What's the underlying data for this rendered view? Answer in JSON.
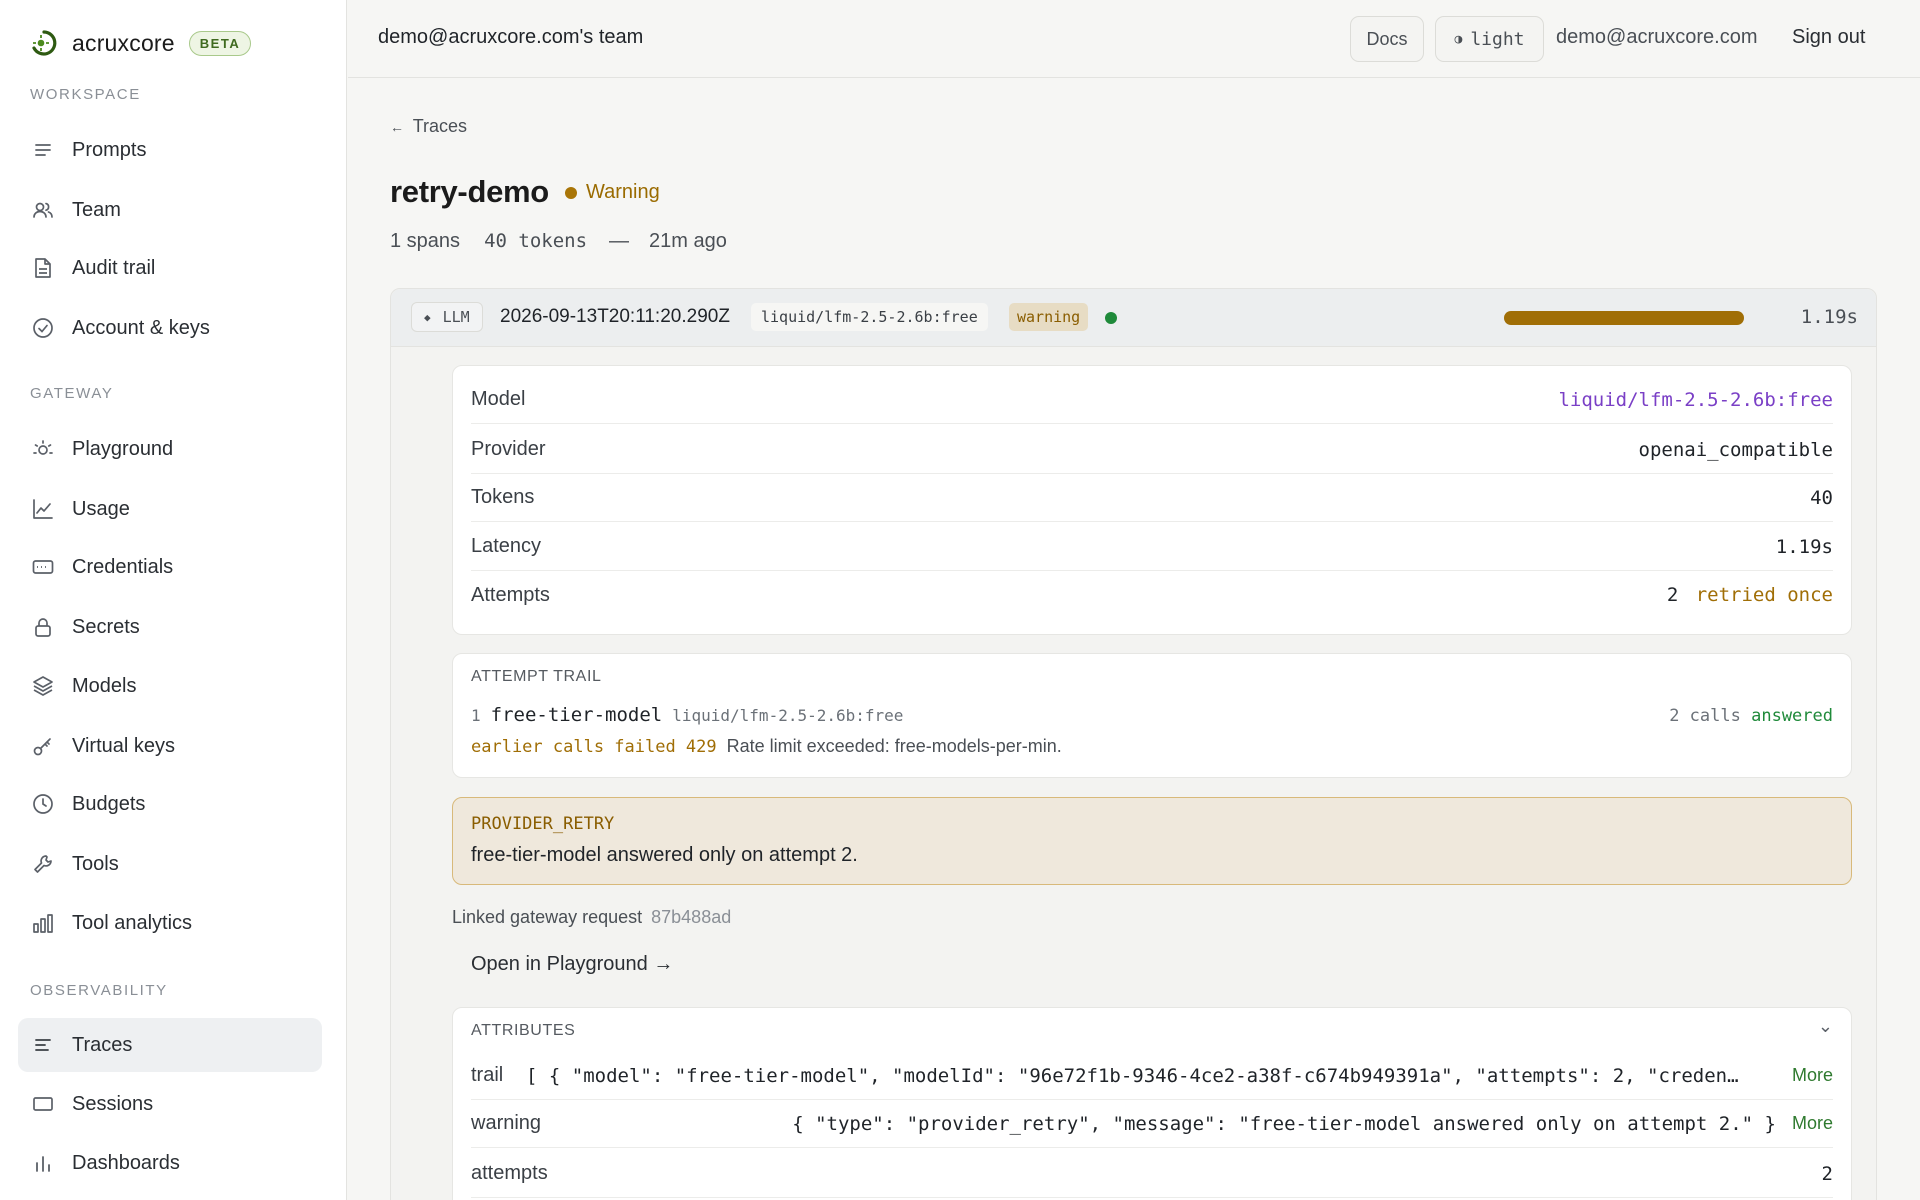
{
  "brand": {
    "name": "acruxcore",
    "badge": "BETA"
  },
  "sidebar": {
    "sections": [
      {
        "label": "WORKSPACE",
        "items": [
          {
            "label": "Prompts",
            "icon": "lines-icon"
          },
          {
            "label": "Team",
            "icon": "users-icon"
          },
          {
            "label": "Audit trail",
            "icon": "document-icon"
          },
          {
            "label": "Account & keys",
            "icon": "check-circle-icon"
          }
        ]
      },
      {
        "label": "GATEWAY",
        "items": [
          {
            "label": "Playground",
            "icon": "sun-icon"
          },
          {
            "label": "Usage",
            "icon": "line-chart-icon"
          },
          {
            "label": "Credentials",
            "icon": "card-icon"
          },
          {
            "label": "Secrets",
            "icon": "lock-icon"
          },
          {
            "label": "Models",
            "icon": "layers-icon"
          },
          {
            "label": "Virtual keys",
            "icon": "key-icon"
          },
          {
            "label": "Budgets",
            "icon": "clock-icon"
          },
          {
            "label": "Tools",
            "icon": "wrench-icon"
          },
          {
            "label": "Tool analytics",
            "icon": "bar-chart-icon"
          }
        ]
      },
      {
        "label": "OBSERVABILITY",
        "items": [
          {
            "label": "Traces",
            "icon": "traces-icon",
            "active": true
          },
          {
            "label": "Sessions",
            "icon": "rectangle-icon"
          },
          {
            "label": "Dashboards",
            "icon": "bars-icon"
          }
        ]
      }
    ]
  },
  "topbar": {
    "team": "demo@acruxcore.com's team",
    "docs": "Docs",
    "theme": "light",
    "theme_icon": "◑",
    "email": "demo@acruxcore.com",
    "signout": "Sign out"
  },
  "trace": {
    "back": "Traces",
    "back_arrow": "←",
    "name": "retry-demo",
    "status": "Warning",
    "spans": "1 spans",
    "tokens": "40 tokens",
    "dash": "—",
    "ago": "21m ago"
  },
  "span": {
    "kind_icon": "◆",
    "kind": "LLM",
    "timestamp": "2026-09-13T20:11:20.290Z",
    "model": "liquid/lfm-2.5-2.6b:free",
    "level": "warning",
    "duration_fraction": 1.0,
    "duration": "1.19s",
    "details": [
      {
        "label": "Model",
        "value": "liquid/lfm-2.5-2.6b:free"
      },
      {
        "label": "Provider",
        "value": "openai_compatible"
      },
      {
        "label": "Tokens",
        "value": "40"
      },
      {
        "label": "Latency",
        "value": "1.19s"
      },
      {
        "label": "Attempts",
        "value": "2",
        "note": "retried once"
      }
    ],
    "attempt_trail": {
      "heading": "ATTEMPT TRAIL",
      "index": "1",
      "model": "free-tier-model",
      "model_id": "liquid/lfm-2.5-2.6b:free",
      "calls": "2 calls",
      "outcome": "answered",
      "failure": "earlier calls failed 429",
      "failure_message": "Rate limit exceeded: free-models-per-min."
    },
    "warning": {
      "type": "PROVIDER_RETRY",
      "message": "free-tier-model answered only on attempt 2."
    },
    "linked_label": "Linked gateway request",
    "linked_id": "87b488ad",
    "open_playground": "Open in Playground →",
    "attributes": {
      "heading": "ATTRIBUTES",
      "collapse": "⌄",
      "rows": [
        {
          "key": "trail",
          "value": "[ { \"model\": \"free-tier-model\", \"modelId\": \"96e72f1b-9346-4ce2-a38f-c674b949391a\", \"attempts\": 2, \"creden…",
          "more": "More"
        },
        {
          "key": "warning",
          "value": "{ \"type\": \"provider_retry\", \"message\": \"free-tier-model answered only on attempt 2.\" }",
          "more": "More"
        },
        {
          "key": "attempts",
          "value": "2"
        }
      ]
    }
  },
  "colors": {
    "warning": "#a06e06",
    "success": "#1f8a3a",
    "model_link": "#7a3fc6"
  }
}
